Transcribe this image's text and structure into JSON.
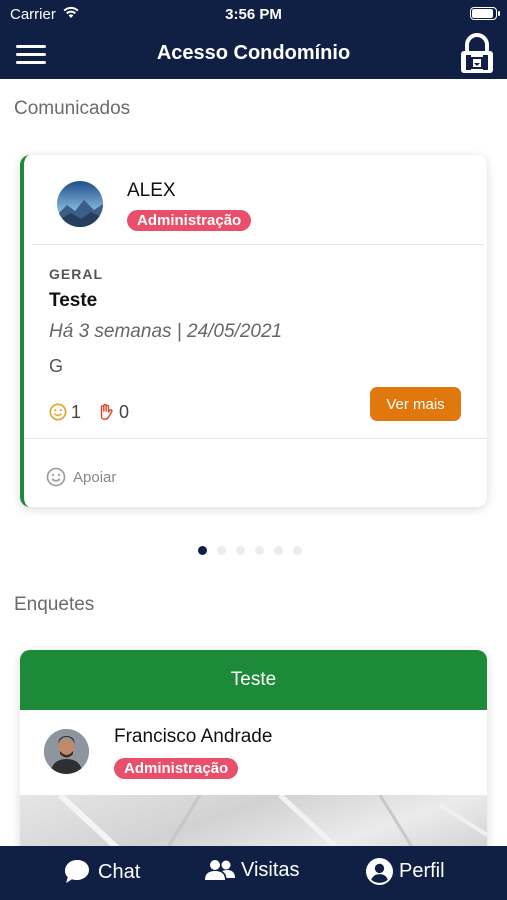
{
  "status_bar": {
    "carrier": "Carrier",
    "time": "3:56 PM"
  },
  "nav": {
    "title": "Acesso Condomínio",
    "menu_icon": "hamburger-menu-icon",
    "lock_icon": "lock-icon"
  },
  "comunicados": {
    "section_title": "Comunicados",
    "card": {
      "author": "ALEX",
      "role": "Administração",
      "category": "GERAL",
      "title": "Teste",
      "date": "Há 3 semanas | 24/05/2021",
      "body": "G",
      "smile_count": "1",
      "hand_count": "0",
      "ver_mais": "Ver mais",
      "apoiar": "Apoiar"
    },
    "pagination": {
      "total": 6,
      "active": 1
    }
  },
  "enquetes": {
    "section_title": "Enquetes",
    "card": {
      "header": "Teste",
      "author": "Francisco Andrade",
      "role": "Administração"
    }
  },
  "tabbar": {
    "chat": "Chat",
    "visitas": "Visitas",
    "perfil": "Perfil"
  },
  "colors": {
    "navy": "#101f44",
    "green": "#1d8a3a",
    "orange": "#e0780d",
    "badge": "#e94f6a"
  }
}
